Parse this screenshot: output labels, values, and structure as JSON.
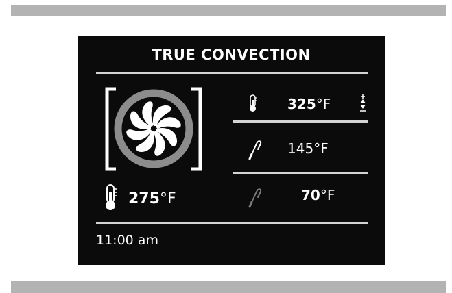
{
  "mode_title": "TRUE CONVECTION",
  "oven": {
    "current_temp": "275",
    "unit": "°F"
  },
  "set_temp": {
    "value": "325",
    "unit": "°F"
  },
  "probe_target": {
    "value": "145",
    "unit": "°F"
  },
  "probe_current": {
    "value": "70",
    "unit": "°F"
  },
  "clock": "11:00 am",
  "icons": {
    "fan": "convection-fan-icon",
    "oven_thermometer": "thermometer-icon",
    "set_thermometer": "thermometer-small-icon",
    "probe": "meat-probe-icon",
    "adjust": "up-down-adjust-icon"
  },
  "colors": {
    "screen_bg": "#0b0b0b",
    "text": "#ffffff",
    "rule": "#d4d4d4",
    "fan_ring": "#8c8c8c",
    "probe_dim": "#7a7a7a",
    "side_bars": "#b3b3b3"
  }
}
